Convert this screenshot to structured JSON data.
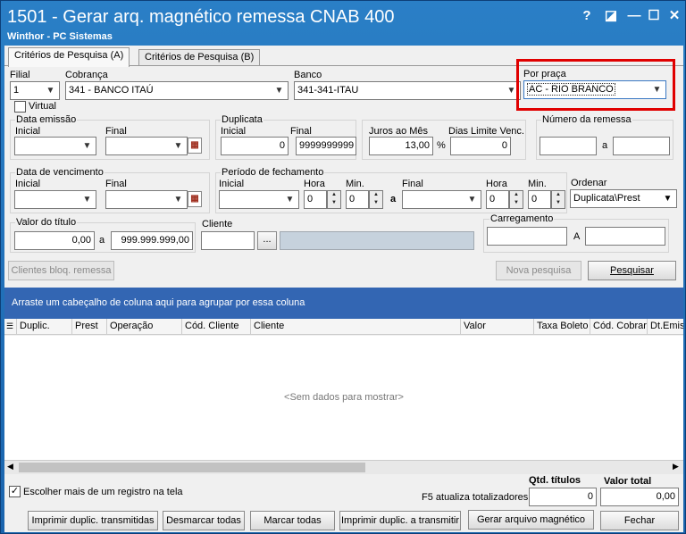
{
  "window": {
    "title": "1501 - Gerar arq. magnético remessa CNAB 400",
    "subtitle": "Winthor - PC Sistemas",
    "controls": {
      "help": "?",
      "restore": "◪",
      "minimize": "—",
      "maximize": "☐",
      "close": "✕"
    }
  },
  "tabs": [
    {
      "label": "Critérios de Pesquisa (A)"
    },
    {
      "label": "Critérios de Pesquisa (B)"
    }
  ],
  "filial": {
    "label": "Filial",
    "value": "1"
  },
  "cobranca": {
    "label": "Cobrança",
    "value": "341 - BANCO ITAÚ"
  },
  "banco": {
    "label": "Banco",
    "value": "341-341-ITAU"
  },
  "praca": {
    "label": "Por praça",
    "value": "AC - RIO BRANCO",
    "highlight": "#e00000"
  },
  "virtual": {
    "label": "Virtual",
    "checked": false
  },
  "data_emissao": {
    "label": "Data emissão",
    "inicial": "Inicial",
    "final": "Final"
  },
  "duplicata": {
    "label": "Duplicata",
    "inicial_label": "Inicial",
    "final_label": "Final",
    "inicial": "0",
    "final": "9999999999"
  },
  "juros": {
    "label": "Juros ao Mês",
    "value": "13,00",
    "unit": "%"
  },
  "dias_limite": {
    "label": "Dias Limite Venc.",
    "value": "0"
  },
  "numero_remessa": {
    "label": "Número da remessa",
    "sep": "a"
  },
  "data_vencimento": {
    "label": "Data de vencimento",
    "inicial": "Inicial",
    "final": "Final"
  },
  "periodo": {
    "label": "Período de fechamento",
    "inicial": "Inicial",
    "hora": "Hora",
    "min": "Min.",
    "final": "Final",
    "sep": "a",
    "hora1": "0",
    "min1": "0",
    "hora2": "0",
    "min2": "0"
  },
  "ordenar": {
    "label": "Ordenar",
    "value": "Duplicata\\Prest"
  },
  "valor_titulo": {
    "label": "Valor do título",
    "min": "0,00",
    "sep": "a",
    "max": "999.999.999,00"
  },
  "cliente": {
    "label": "Cliente",
    "lookup": "..."
  },
  "carregamento": {
    "label": "Carregamento",
    "sep": "A"
  },
  "buttons": {
    "clientes_bloq": "Clientes bloq. remessa",
    "nova_pesquisa": "Nova pesquisa",
    "pesquisar": "Pesquisar",
    "imprimir_transmitidas": "Imprimir duplic. transmitidas",
    "desmarcar": "Desmarcar todas",
    "marcar": "Marcar todas",
    "imprimir_transmitir": "Imprimir duplic. a transmitir",
    "gerar_arquivo": "Gerar arquivo magnético",
    "fechar": "Fechar"
  },
  "grid": {
    "group_hint": "Arraste um cabeçalho de coluna aqui para agrupar por essa coluna",
    "columns": [
      "Duplic.",
      "Prest",
      "Operação",
      "Cód. Cliente",
      "Cliente",
      "Valor",
      "Taxa Boleto",
      "Cód. Cobrar",
      "Dt.Emis"
    ],
    "empty": "<Sem dados para mostrar>"
  },
  "footer": {
    "multi_select": {
      "label": "Escolher mais de um registro na tela",
      "checked": true
    },
    "f5_hint": "F5 atualiza totalizadores",
    "qtd_titulos": {
      "label": "Qtd. títulos",
      "value": "0"
    },
    "valor_total": {
      "label": "Valor total",
      "value": "0,00"
    }
  },
  "colors": {
    "titlebar": "#1b6fb8",
    "grid_group_bar": "#3366b3",
    "highlight": "#e00000"
  }
}
